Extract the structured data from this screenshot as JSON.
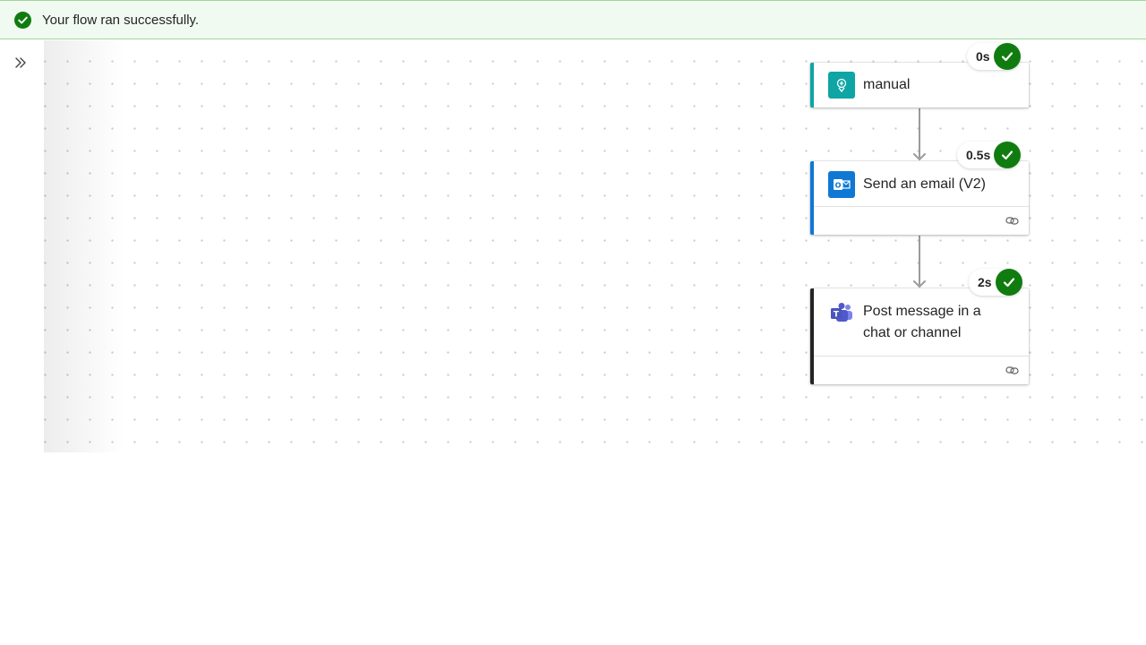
{
  "banner": {
    "message": "Your flow ran successfully.",
    "icon": "success-check-icon",
    "color": "#107c10"
  },
  "sidebar": {
    "expand_icon": "chevron-double-right-icon"
  },
  "flow": {
    "steps": [
      {
        "title": "manual",
        "duration": "0s",
        "status": "succeeded",
        "icon": "manual-trigger-icon",
        "accent": "#0fa5a5"
      },
      {
        "title": "Send an email (V2)",
        "duration": "0.5s",
        "status": "succeeded",
        "icon": "outlook-icon",
        "accent": "#0f78d4"
      },
      {
        "title_line1": "Post message in a",
        "title_line2": "chat or channel",
        "duration": "2s",
        "status": "succeeded",
        "icon": "teams-icon",
        "accent": "#242424"
      }
    ],
    "connection_icon": "link-icon"
  }
}
